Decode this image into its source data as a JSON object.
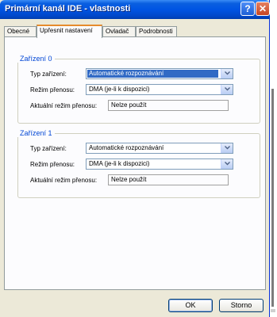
{
  "window": {
    "title": "Primární kanál IDE - vlastnosti"
  },
  "titlebar": {
    "help_icon": "?",
    "close_icon": "✕"
  },
  "tabs": [
    {
      "label": "Obecné",
      "active": false
    },
    {
      "label": "Upřesnit nastavení",
      "active": true
    },
    {
      "label": "Ovladač",
      "active": false
    },
    {
      "label": "Podrobnosti",
      "active": false
    }
  ],
  "devices": [
    {
      "title": "Zařízení 0",
      "type_label": "Typ zařízení:",
      "type_value": "Automatické rozpoznávání",
      "mode_label": "Režim přenosu:",
      "mode_value": "DMA (je-li k dispozici)",
      "current_label": "Aktuální režim přenosu:",
      "current_value": "Nelze použít"
    },
    {
      "title": "Zařízení 1",
      "type_label": "Typ zařízení:",
      "type_value": "Automatické rozpoznávání",
      "mode_label": "Režim přenosu:",
      "mode_value": "DMA (je-li k dispozici)",
      "current_label": "Aktuální režim přenosu:",
      "current_value": "Nelze použít"
    }
  ],
  "buttons": {
    "ok": "OK",
    "cancel": "Storno"
  },
  "colors": {
    "titlebar": "#0054e3",
    "dialog": "#ece9d8",
    "group_title": "#0046d5",
    "active_tab_accent": "#e68b2c",
    "selection": "#316ac5"
  }
}
